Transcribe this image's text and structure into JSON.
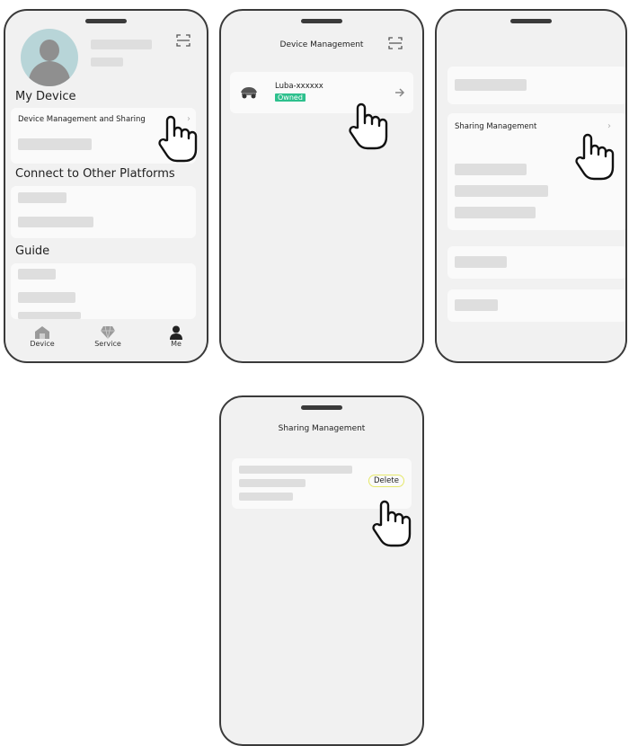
{
  "screen1": {
    "my_device_heading": "My Device",
    "device_mgmt_label": "Device Management and Sharing",
    "connect_heading": "Connect to Other Platforms",
    "guide_heading": "Guide",
    "nav": [
      {
        "label": "Device",
        "icon": "home-icon"
      },
      {
        "label": "Service",
        "icon": "diamond-icon"
      },
      {
        "label": "Me",
        "icon": "person-icon"
      }
    ]
  },
  "screen2": {
    "title": "Device Management",
    "device_name": "Luba-xxxxxx",
    "device_badge": "Owned",
    "colors": {
      "badge_bg": "#2dc08d"
    }
  },
  "screen3": {
    "sharing_label": "Sharing Management"
  },
  "screen4": {
    "title": "Sharing Management",
    "delete_label": "Delete",
    "colors": {
      "delete_ring": "#e5e86a"
    }
  }
}
